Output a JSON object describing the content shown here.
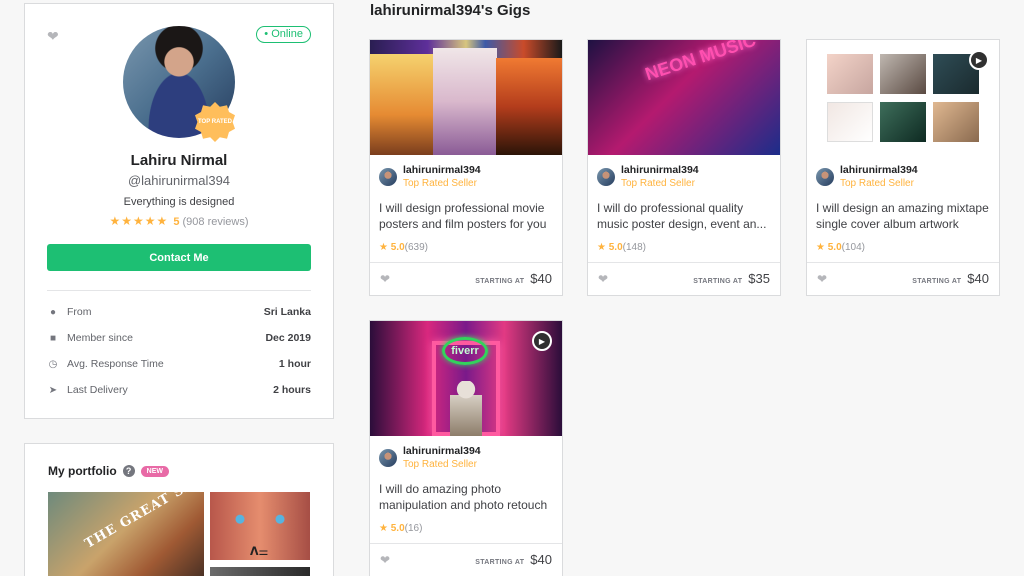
{
  "profile": {
    "status": "• Online",
    "badge": "TOP RATED",
    "name": "Lahiru Nirmal",
    "handle": "@lahirunirmal394",
    "tagline": "Everything is designed",
    "stars": "★★★★★",
    "rating": "5",
    "reviews": "(908 reviews)",
    "contact_label": "Contact Me",
    "stats": [
      {
        "icon": "location-pin-icon",
        "label": "From",
        "value": "Sri Lanka"
      },
      {
        "icon": "user-icon",
        "label": "Member since",
        "value": "Dec 2019"
      },
      {
        "icon": "clock-icon",
        "label": "Avg. Response Time",
        "value": "1 hour"
      },
      {
        "icon": "send-icon",
        "label": "Last Delivery",
        "value": "2 hours"
      }
    ]
  },
  "portfolio": {
    "title": "My portfolio",
    "help": "?",
    "new_badge": "NEW",
    "main_text": "THE GREAT SALAMI",
    "thumb_text": "ᐱ⚌"
  },
  "gigs": {
    "title": "lahirunirmal394's Gigs",
    "items": [
      {
        "seller": "lahirunirmal394",
        "level": "Top Rated Seller",
        "desc": "I will design professional movie posters and film posters for you",
        "rating": "5.0",
        "count": "(639)",
        "starting": "STARTING AT",
        "price": "$40"
      },
      {
        "seller": "lahirunirmal394",
        "level": "Top Rated Seller",
        "desc": "I will do professional quality music poster design, event an...",
        "rating": "5.0",
        "count": "(148)",
        "starting": "STARTING AT",
        "price": "$35",
        "thumb_text": "NEON MUSIC"
      },
      {
        "seller": "lahirunirmal394",
        "level": "Top Rated Seller",
        "desc": "I will design an amazing mixtape single cover album artwork",
        "rating": "5.0",
        "count": "(104)",
        "starting": "STARTING AT",
        "price": "$40"
      },
      {
        "seller": "lahirunirmal394",
        "level": "Top Rated Seller",
        "desc": "I will do amazing photo manipulation and photo retouch",
        "rating": "5.0",
        "count": "(16)",
        "starting": "STARTING AT",
        "price": "$40",
        "thumb_text": "fiverr"
      }
    ]
  },
  "colors": {
    "accent": "#1dbf73",
    "star": "#ffb33e",
    "badge_pink": "#e86aa6"
  }
}
